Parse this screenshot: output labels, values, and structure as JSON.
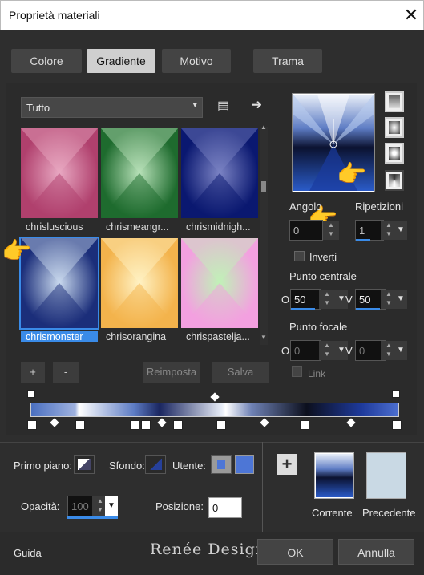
{
  "window": {
    "title": "Proprietà materiali",
    "close_glyph": "✕"
  },
  "tabs": [
    {
      "label": "Colore"
    },
    {
      "label": "Gradiente",
      "selected": true
    },
    {
      "label": "Motivo"
    },
    {
      "label": "Trama"
    }
  ],
  "category": {
    "value": "Tutto"
  },
  "gradients": [
    {
      "label": "chrisluscious",
      "colors": [
        "#b0406d",
        "#e8a8c2"
      ]
    },
    {
      "label": "chrismeangr...",
      "colors": [
        "#1e6b2e",
        "#b7e1b8"
      ]
    },
    {
      "label": "chrismidnigh...",
      "colors": [
        "#0a1870",
        "#7b83c4"
      ]
    },
    {
      "label": "chrismonster",
      "colors": [
        "#1b2e7a",
        "#c9d9ee"
      ],
      "selected": true
    },
    {
      "label": "chrisorangina",
      "colors": [
        "#f3b34c",
        "#fff2c4"
      ]
    },
    {
      "label": "chrispastelja...",
      "colors": [
        "#f3a0e0",
        "#c0f2b7"
      ]
    }
  ],
  "list_buttons": {
    "add": "+",
    "remove": "-",
    "reset": "Reimposta",
    "save": "Salva"
  },
  "angle": {
    "label": "Angolo",
    "value": "0"
  },
  "repeats": {
    "label": "Ripetizioni",
    "value": "1"
  },
  "invert": {
    "label": "Inverti"
  },
  "center": {
    "label": "Punto centrale",
    "h_label": "O",
    "h_value": "50",
    "v_label": "V",
    "v_value": "50"
  },
  "focal": {
    "label": "Punto focale",
    "h_label": "O",
    "h_value": "0",
    "v_label": "V",
    "v_value": "0"
  },
  "link": {
    "label": "Link"
  },
  "foreground": {
    "label": "Primo piano:"
  },
  "background": {
    "label": "Sfondo:"
  },
  "user": {
    "label": "Utente:",
    "color": "#4d76d6"
  },
  "opacity": {
    "label": "Opacità:",
    "value": "100"
  },
  "position": {
    "label": "Posizione:",
    "value": "0"
  },
  "current": {
    "label": "Corrente"
  },
  "previous": {
    "label": "Precedente",
    "color": "#c9d9e4"
  },
  "footer": {
    "help": "Guida",
    "ok": "OK",
    "cancel": "Annulla",
    "watermark": "Renée Design"
  }
}
